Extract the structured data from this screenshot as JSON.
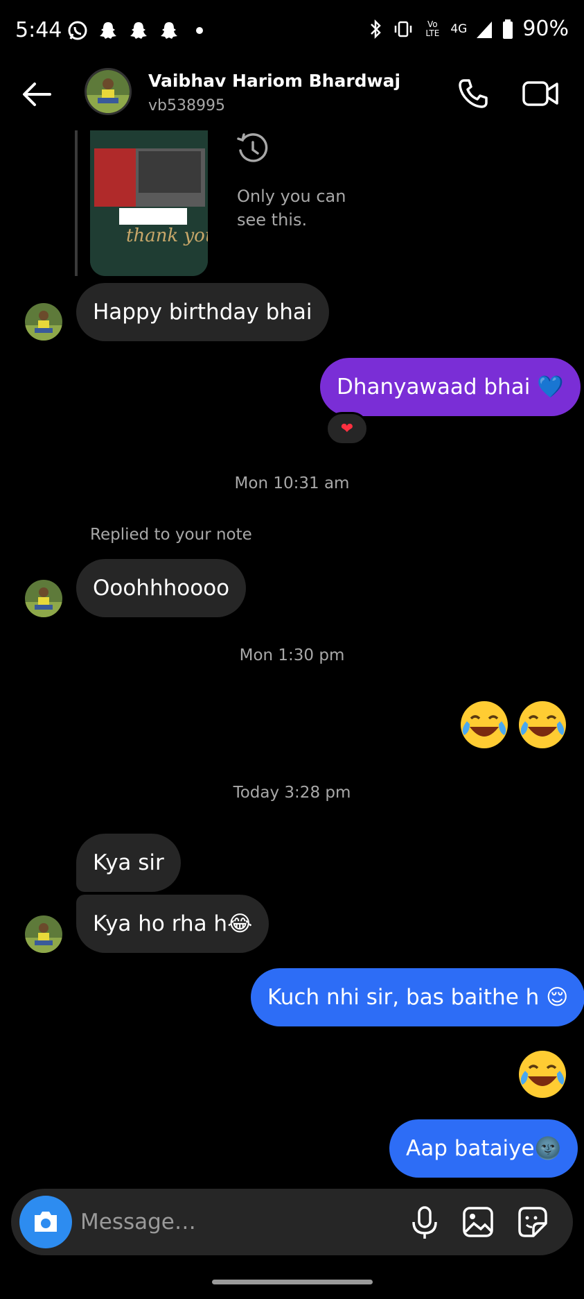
{
  "status_bar": {
    "time": "5:44",
    "network": "4G",
    "volte": "Vo LTE",
    "battery": "90%",
    "notification_icons": [
      "whatsapp-icon",
      "snapchat-icon",
      "snapchat-icon",
      "snapchat-icon",
      "dot-icon"
    ]
  },
  "header": {
    "contact_name": "Vaibhav Hariom Bhardwaj",
    "username": "vb538995"
  },
  "story_reply": {
    "visibility_note": "Only you can see this.",
    "thumbnail_text": "thank you so much"
  },
  "messages": [
    {
      "side": "in",
      "text": "Happy birthday bhai"
    },
    {
      "side": "out",
      "text": "Dhanyawaad bhai 💙",
      "reaction": "❤"
    },
    {
      "timestamp": "Mon 10:31 am"
    },
    {
      "side": "in",
      "context": "Replied to your note",
      "text": "Ooohhhoooo"
    },
    {
      "timestamp": "Mon 1:30 pm"
    },
    {
      "side": "out",
      "emoji": "😂😂"
    },
    {
      "timestamp": "Today 3:28 pm"
    },
    {
      "side": "in",
      "text": "Kya sir"
    },
    {
      "side": "in",
      "text": "Kya ho rha h😂"
    },
    {
      "side": "out",
      "text": "Kuch nhi sir, bas baithe h 😌"
    },
    {
      "side": "out",
      "emoji": "😂"
    },
    {
      "side": "out",
      "text": "Aap bataiye🌚"
    }
  ],
  "composer": {
    "placeholder": "Message…"
  },
  "colors": {
    "background": "#000000",
    "incoming_bubble": "#262626",
    "outgoing_purple": "#7a2ed6",
    "outgoing_blue": "#2d6df6",
    "camera_button": "#2d8cf0",
    "secondary_text": "#a8a8a8"
  }
}
